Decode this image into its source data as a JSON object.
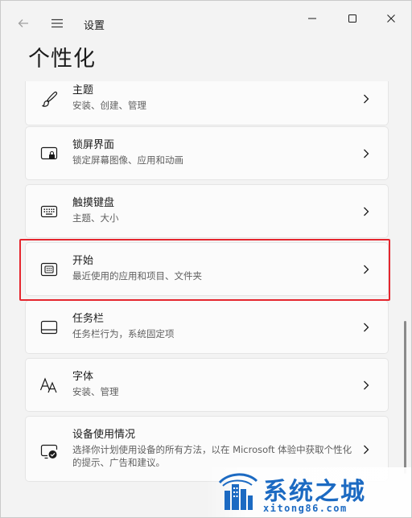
{
  "window": {
    "title": "设置",
    "icons": {
      "back": "back-arrow-icon",
      "menu": "hamburger-menu-icon",
      "minimize": "minimize-icon",
      "maximize": "maximize-icon",
      "close": "close-icon"
    }
  },
  "page": {
    "title": "个性化"
  },
  "items": [
    {
      "title": "主题",
      "subtitle": "安装、创建、管理",
      "icon": "brush-icon"
    },
    {
      "title": "锁屏界面",
      "subtitle": "锁定屏幕图像、应用和动画",
      "icon": "lock-screen-icon"
    },
    {
      "title": "触摸键盘",
      "subtitle": "主题、大小",
      "icon": "keyboard-icon"
    },
    {
      "title": "开始",
      "subtitle": "最近使用的应用和项目、文件夹",
      "icon": "start-menu-icon"
    },
    {
      "title": "任务栏",
      "subtitle": "任务栏行为，系统固定项",
      "icon": "taskbar-icon"
    },
    {
      "title": "字体",
      "subtitle": "安装、管理",
      "icon": "fonts-icon"
    },
    {
      "title": "设备使用情况",
      "subtitle": "选择你计划使用设备的所有方法，以在 Microsoft 体验中获取个性化的提示、广告和建议。",
      "icon": "device-usage-icon"
    }
  ],
  "highlighted_item": "开始",
  "watermark": {
    "name": "系统之城",
    "url": "xitong86.com"
  },
  "colors": {
    "highlight": "#e5262e",
    "watermark": "#1c6ac2",
    "background": "#f3f3f3",
    "card": "#fbfbfb"
  }
}
